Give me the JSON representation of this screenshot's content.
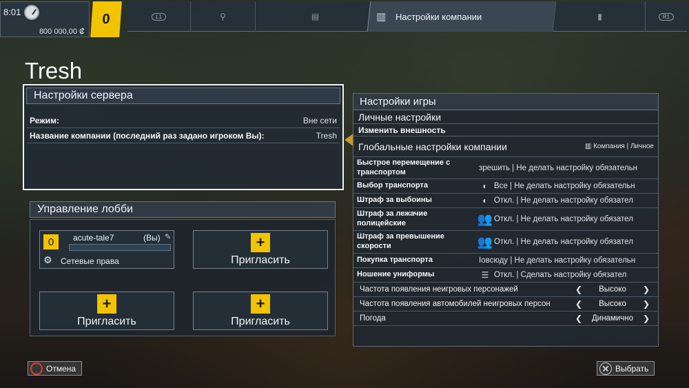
{
  "status": {
    "time": "8:01",
    "money": "800 000,00 ₡",
    "rank": "0"
  },
  "nav": {
    "l1_tag": "L1",
    "r1_tag": "R1",
    "active_label": "Настройки компании"
  },
  "page_title": "Tresh",
  "server": {
    "title": "Настройки сервера",
    "rows": [
      {
        "label": "Режим:",
        "value": "Вне сети"
      },
      {
        "label": "Название компании (последний раз задано игроком Вы):",
        "value": "Tresh"
      }
    ]
  },
  "lobby": {
    "title": "Управление лобби",
    "player": {
      "rank": "0",
      "name": "acute-tale7",
      "you": "(Вы)",
      "rights": "Сетевые права"
    },
    "invite_label": "Пригласить"
  },
  "game": {
    "title": "Настройки игры",
    "personal_title": "Личные настройки",
    "appearance_label": "Изменить внешность",
    "global_title": "Глобальные настройки компании",
    "global_legend": "Компания | Личное",
    "rows": [
      {
        "label": "Быстрое перемещение с транспортом",
        "value": "зрешить | Не делать настройку обязательн"
      },
      {
        "label": "Выбор транспорта",
        "value": "Все | Не делать настройку обязательн"
      },
      {
        "label": "Штраф за выбоины",
        "value": "Откл. | Не делать настройку обязател"
      },
      {
        "label": "Штраф за лежачие полицейские",
        "value": "Откл. | Не делать настройку обязател"
      },
      {
        "label": "Штраф за превышение скорости",
        "value": "Откл. | Не делать настройку обязател"
      },
      {
        "label": "Покупка транспорта",
        "value": "Іовсюду | Не делать настройку обязательн"
      },
      {
        "label": "Ношение униформы",
        "value": "Откл. | Сделать настройку обязател"
      }
    ],
    "selectors": [
      {
        "label": "Частота появления неигровых персонажей",
        "value": "Высоко"
      },
      {
        "label": "Частота появления автомобилей неигровых персон",
        "value": "Высоко"
      },
      {
        "label": "Погода",
        "value": "Динамично"
      }
    ]
  },
  "footer": {
    "cancel": "Отмена",
    "select": "Выбрать"
  },
  "colors": {
    "accent": "#f2c300",
    "panel_header": "#323c48"
  }
}
